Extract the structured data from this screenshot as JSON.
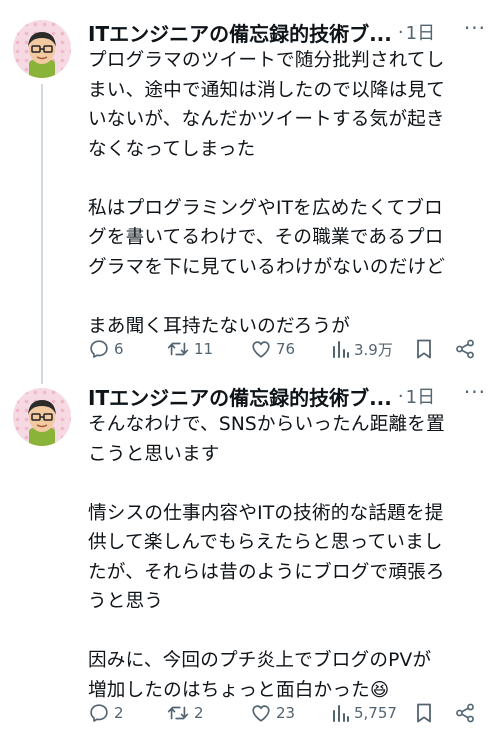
{
  "tweets": [
    {
      "author": "ITエンジニアの備忘録的技術ブ...",
      "separator": "·",
      "time": "1日",
      "more": "···",
      "lines": [
        "プログラマのツイートで随分批判されてし",
        "まい、途中で通知は消したので以降は見て",
        "いないが、なんだかツイートする気が起き",
        "なくなってしまった",
        "",
        "私はプログラミングやITを広めたくてブロ",
        "グを書いてるわけで、その職業であるプロ",
        "グラマを下に見ているわけがないのだけど",
        "",
        "まあ聞く耳持たないのだろうが"
      ],
      "replies": "6",
      "retweets": "11",
      "likes": "76",
      "views": "3.9万"
    },
    {
      "author": "ITエンジニアの備忘録的技術ブ...",
      "separator": "·",
      "time": "1日",
      "more": "···",
      "lines": [
        "そんなわけで、SNSからいったん距離を置",
        "こうと思います",
        "",
        "情シスの仕事内容やITの技術的な話題を提",
        "供して楽しんでもらえたらと思っていまし",
        "たが、それらは昔のようにブログで頑張ろ",
        "うと思う",
        "",
        "因みに、今回のプチ炎上でブログのPVが",
        "増加したのはちょっと面白かった😆"
      ],
      "replies": "2",
      "retweets": "2",
      "likes": "23",
      "views": "5,757"
    }
  ],
  "icons": [
    "reply-icon",
    "retweet-icon",
    "like-icon",
    "views-icon",
    "bookmark-icon",
    "share-icon"
  ],
  "colors": {
    "muted": "#536471",
    "text": "#0f1419",
    "thread_line": "#cfd9de",
    "avatar_bg": "#f6d9e2"
  }
}
